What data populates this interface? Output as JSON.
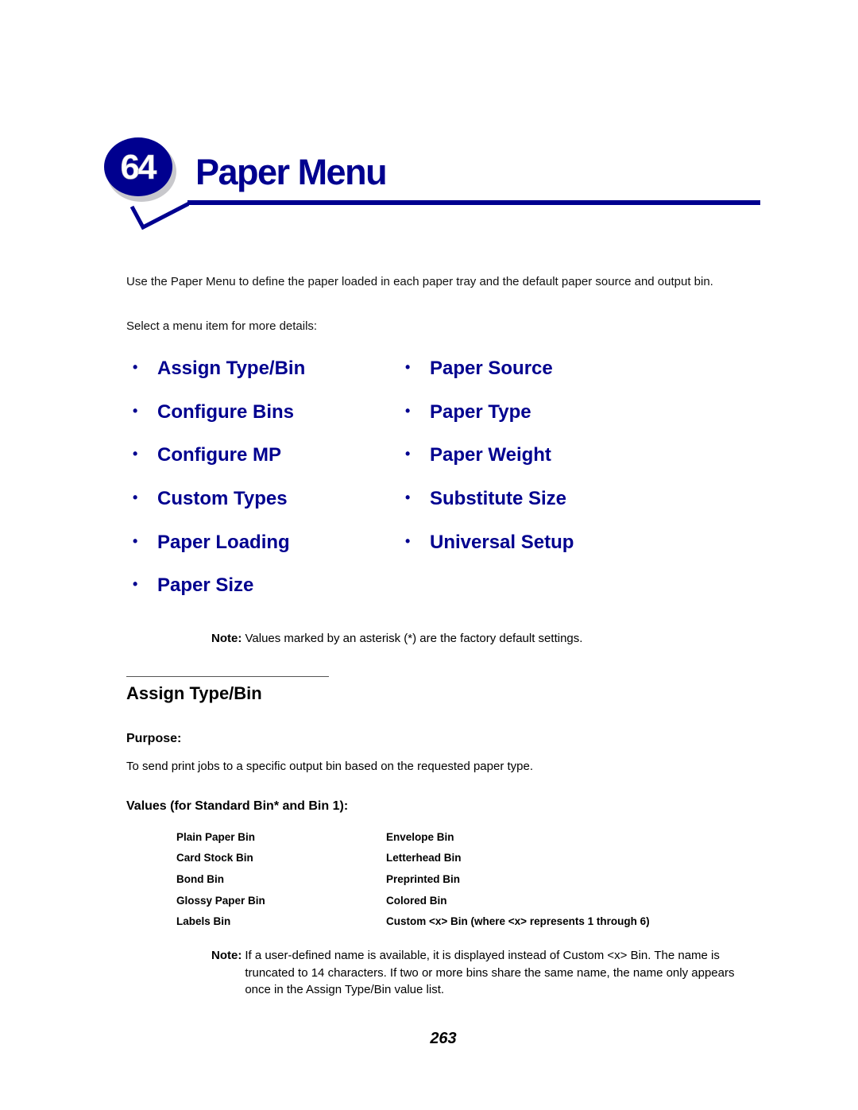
{
  "chapter": {
    "number": "64",
    "title": "Paper Menu",
    "accent_color": "#00008f"
  },
  "intro": {
    "text": "Use the Paper Menu to define the paper loaded in each paper tray and the default paper source and output bin.",
    "select_hint": "Select a menu item for more details:"
  },
  "menu": {
    "bullet": "•",
    "left": [
      {
        "label": "Assign Type/Bin"
      },
      {
        "label": "Configure Bins"
      },
      {
        "label": "Configure MP"
      },
      {
        "label": "Custom Types"
      },
      {
        "label": "Paper Loading"
      },
      {
        "label": "Paper Size"
      }
    ],
    "right": [
      {
        "label": "Paper Source"
      },
      {
        "label": "Paper Type"
      },
      {
        "label": "Paper Weight"
      },
      {
        "label": "Substitute Size"
      },
      {
        "label": "Universal Setup"
      }
    ]
  },
  "note_defaults": {
    "label": "Note:",
    "text": "Values marked by an asterisk (*) are the factory default settings."
  },
  "section": {
    "title": "Assign Type/Bin",
    "purpose_heading": "Purpose:",
    "purpose_text": "To send print jobs to a specific output bin based on the requested paper type.",
    "values_heading": "Values (for Standard Bin* and Bin 1):",
    "values": [
      [
        "Plain Paper Bin",
        "Envelope Bin"
      ],
      [
        "Card Stock Bin",
        "Letterhead Bin"
      ],
      [
        "Bond Bin",
        "Preprinted Bin"
      ],
      [
        "Glossy Paper Bin",
        "Colored Bin"
      ],
      [
        "Labels Bin",
        "Custom <x> Bin (where <x> represents 1 through 6)"
      ]
    ],
    "note": {
      "label": "Note:",
      "text": "If a user-defined name is available, it is displayed instead of Custom <x> Bin. The name is truncated to 14 characters. If two or more bins share the same name, the name only appears once in the Assign Type/Bin value list."
    }
  },
  "page_number": "263"
}
